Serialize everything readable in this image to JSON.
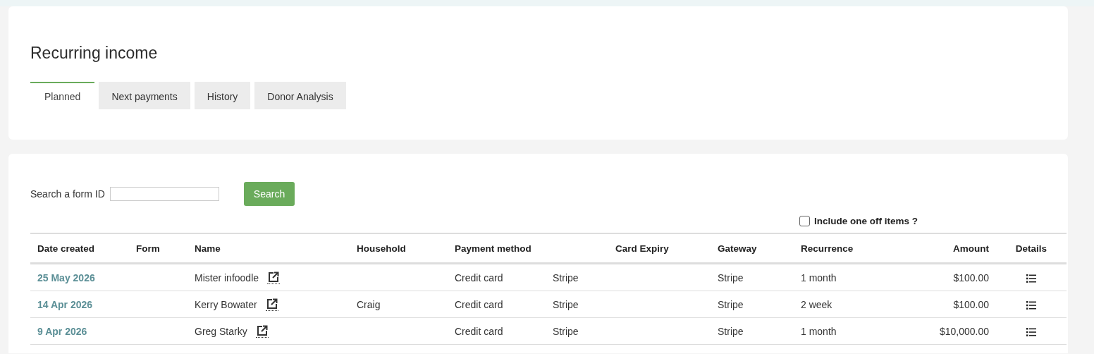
{
  "page": {
    "title": "Recurring income"
  },
  "tabs": [
    {
      "label": "Planned",
      "selected": true
    },
    {
      "label": "Next payments",
      "selected": false
    },
    {
      "label": "History",
      "selected": false
    },
    {
      "label": "Donor Analysis",
      "selected": false
    }
  ],
  "search": {
    "label": "Search a form ID",
    "button": "Search"
  },
  "include_one_off": {
    "label": "Include one off items ?",
    "checked": false
  },
  "table": {
    "columns": [
      "Date created",
      "Form",
      "Name",
      "Household",
      "Payment method",
      "Card Expiry",
      "Gateway",
      "Recurrence",
      "Amount",
      "Details"
    ],
    "rows": [
      {
        "date_created": "25 May 2026",
        "name": "Mister infoodle",
        "payment_method": "Credit card",
        "column_6": "Stripe",
        "gateway": "Stripe",
        "recurrence": "1 month",
        "amount": "$100.00"
      },
      {
        "date_created": "14 Apr 2026",
        "name": "Kerry Bowater",
        "household": "Craig",
        "payment_method": "Credit card",
        "column_6": "Stripe",
        "gateway": "Stripe",
        "recurrence": "2 week",
        "amount": "$100.00"
      },
      {
        "date_created": "9 Apr 2026",
        "name": "Greg Starky",
        "payment_method": "Credit card",
        "column_6": "Stripe",
        "gateway": "Stripe",
        "recurrence": "1 month",
        "amount": "$10,000.00"
      }
    ]
  }
}
